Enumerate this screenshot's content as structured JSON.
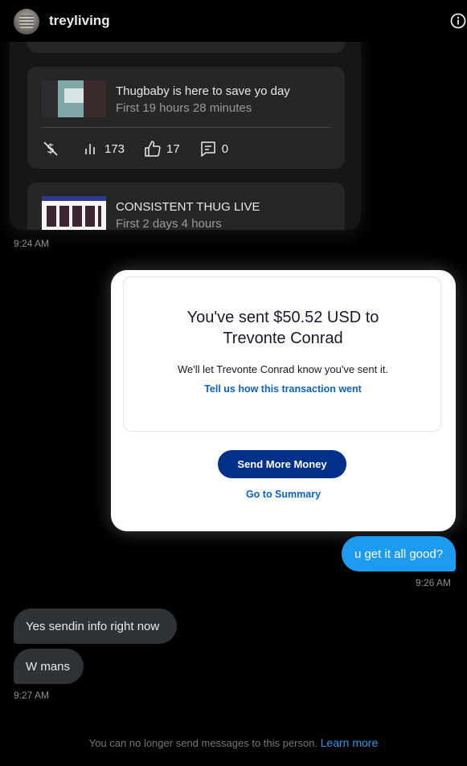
{
  "header": {
    "username": "treyliving",
    "avatar_icon": "avatar",
    "info_icon": "info-icon"
  },
  "embed": {
    "cards": [
      {
        "title": "Thugbaby is here to save yo day",
        "subtitle": "First 19 hours 28 minutes",
        "stats": {
          "views": "173",
          "likes": "17",
          "comments": "0"
        }
      },
      {
        "title": "CONSISTENT THUG LIVE",
        "subtitle": "First 2 days 4 hours"
      }
    ],
    "timestamp": "9:24 AM"
  },
  "paypal": {
    "title_line1": "You've sent $50.52 USD to",
    "title_line2": "Trevonte Conrad",
    "note": "We'll let Trevonte Conrad know you've sent it.",
    "feedback_link": "Tell us how this transaction went",
    "send_more_button": "Send More Money",
    "summary_link": "Go to Summary",
    "button_color": "#003087",
    "link_color": "#0a63c9"
  },
  "messages": {
    "outgoing": {
      "text": "u get it all good?",
      "timestamp": "9:26 AM",
      "bubble_color": "#1d9bf0"
    },
    "incoming": [
      {
        "text": "Yes sendin info right now"
      },
      {
        "text": "W mans"
      }
    ],
    "incoming_timestamp": "9:27 AM"
  },
  "footer": {
    "notice": "You can no longer send messages to this person.",
    "learn_more": "Learn more"
  }
}
